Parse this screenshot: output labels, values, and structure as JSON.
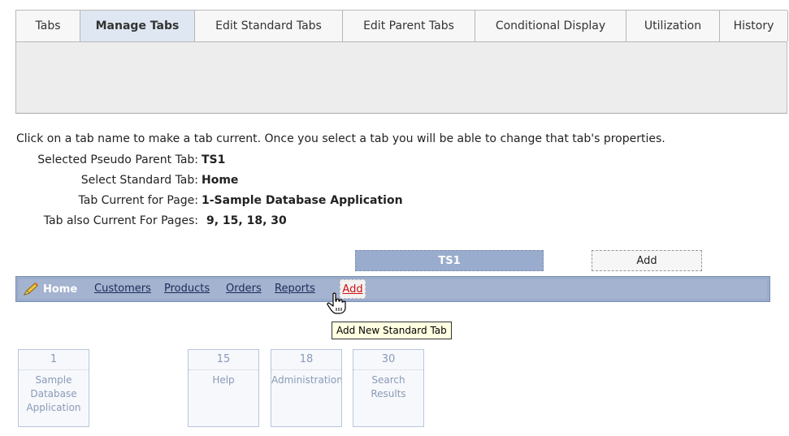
{
  "tabs": [
    {
      "label": "Tabs",
      "active": false
    },
    {
      "label": "Manage Tabs",
      "active": true
    },
    {
      "label": "Edit Standard Tabs",
      "active": false
    },
    {
      "label": "Edit Parent Tabs",
      "active": false
    },
    {
      "label": "Conditional Display",
      "active": false
    },
    {
      "label": "Utilization",
      "active": false
    },
    {
      "label": "History",
      "active": false
    }
  ],
  "intro": "Click on a tab name to make a tab current. Once you select a tab you will be able to change that tab's properties.",
  "info": {
    "parent_label": "Selected Pseudo Parent Tab:",
    "parent_value": "TS1",
    "standard_label": "Select Standard Tab:",
    "standard_value": "Home",
    "current_label": "Tab Current for Page:",
    "current_value": "1-Sample Database Application",
    "also_label": "Tab also Current For Pages:",
    "also_value": "9, 15, 18, 30"
  },
  "parent_tabs": {
    "current": "TS1",
    "add_label": "Add"
  },
  "standard_tabs": {
    "current": "Home",
    "links": [
      "Customers",
      "Products",
      "Orders",
      "Reports"
    ],
    "add_label": "Add"
  },
  "tooltip": "Add New Standard Tab",
  "pages": [
    {
      "number": "1",
      "name": "Sample\nDatabase\nApplication"
    },
    {
      "number": "15",
      "name": "Help"
    },
    {
      "number": "18",
      "name": "Administration"
    },
    {
      "number": "30",
      "name": "Search\nResults"
    }
  ],
  "colors": {
    "active_tab_bg": "#dfe7f2",
    "tabbar_blue": "#9aaccd",
    "add_link_red": "#d01010",
    "tooltip_bg": "#ffffe1"
  },
  "icons": {
    "home_tab_icon": "pencil-icon",
    "cursor": "hand-pointer-icon"
  }
}
